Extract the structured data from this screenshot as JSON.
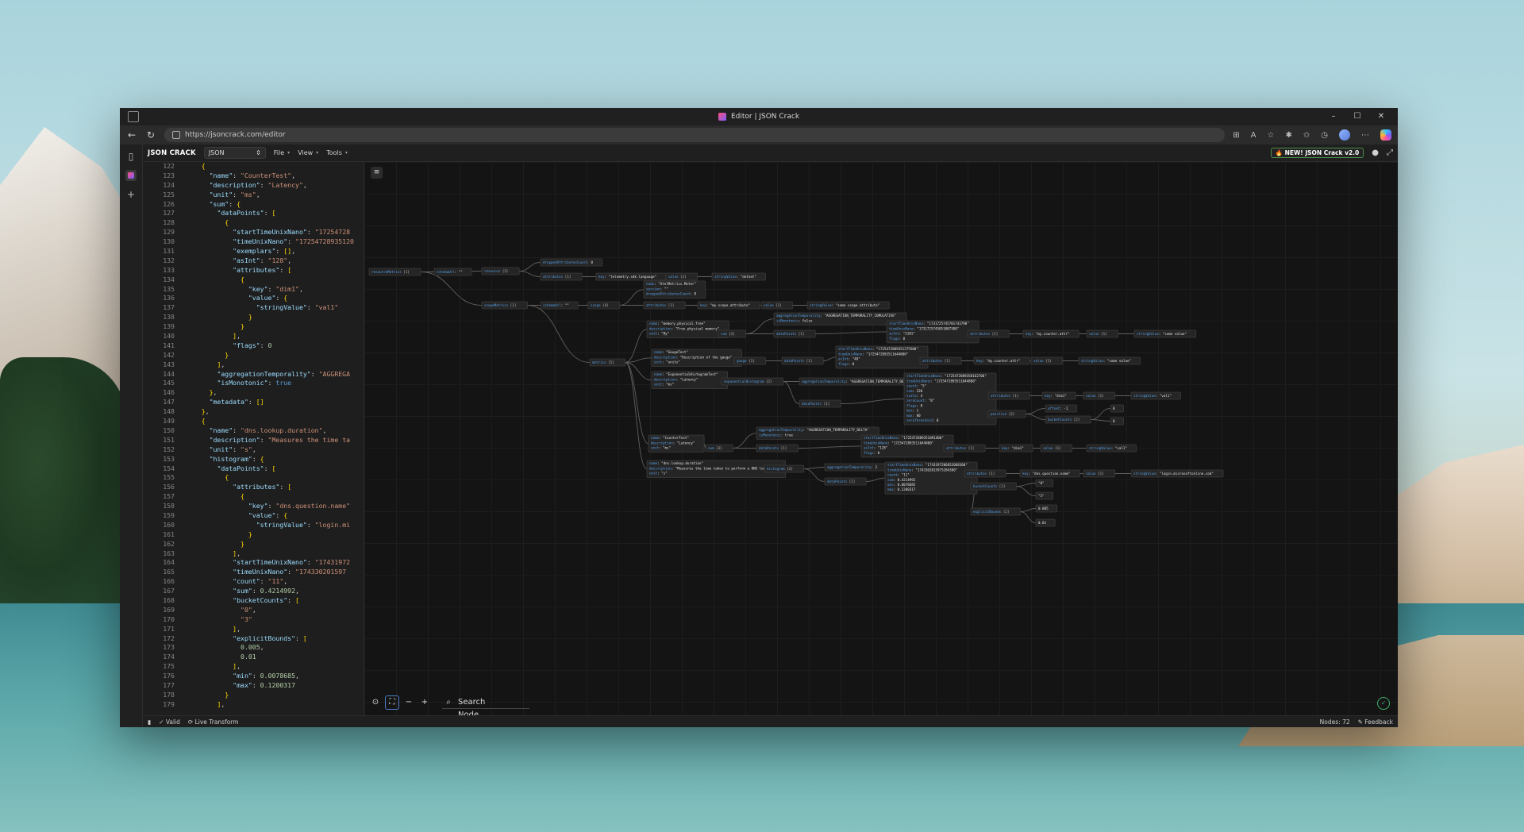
{
  "browser": {
    "tab_title": "Editor | JSON Crack",
    "url": "https://jsoncrack.com/editor"
  },
  "app": {
    "brand": "JSON CRACK",
    "format": "JSON",
    "menus": [
      "File",
      "View",
      "Tools"
    ],
    "new_button": "NEW! JSON Crack v2.0"
  },
  "editor": {
    "lines": [
      {
        "n": "122",
        "t": "    {"
      },
      {
        "n": "123",
        "t": "      \"name\": \"CounterTest\","
      },
      {
        "n": "124",
        "t": "      \"description\": \"Latency\","
      },
      {
        "n": "125",
        "t": "      \"unit\": \"ms\","
      },
      {
        "n": "126",
        "t": "      \"sum\": {"
      },
      {
        "n": "127",
        "t": "        \"dataPoints\": ["
      },
      {
        "n": "128",
        "t": "          {"
      },
      {
        "n": "129",
        "t": "            \"startTimeUnixNano\": \"17254728"
      },
      {
        "n": "130",
        "t": "            \"timeUnixNano\": \"17254728935120"
      },
      {
        "n": "131",
        "t": "            \"exemplars\": [],"
      },
      {
        "n": "132",
        "t": "            \"asInt\": \"128\","
      },
      {
        "n": "133",
        "t": "            \"attributes\": ["
      },
      {
        "n": "134",
        "t": "              {"
      },
      {
        "n": "135",
        "t": "                \"key\": \"dim1\","
      },
      {
        "n": "136",
        "t": "                \"value\": {"
      },
      {
        "n": "137",
        "t": "                  \"stringValue\": \"val1\""
      },
      {
        "n": "138",
        "t": "                }"
      },
      {
        "n": "139",
        "t": "              }"
      },
      {
        "n": "140",
        "t": "            ],"
      },
      {
        "n": "141",
        "t": "            \"flags\": 0"
      },
      {
        "n": "142",
        "t": "          }"
      },
      {
        "n": "143",
        "t": "        ],"
      },
      {
        "n": "144",
        "t": "        \"aggregationTemporality\": \"AGGREGA"
      },
      {
        "n": "145",
        "t": "        \"isMonotonic\": true"
      },
      {
        "n": "146",
        "t": "      },"
      },
      {
        "n": "147",
        "t": "      \"metadata\": []"
      },
      {
        "n": "148",
        "t": "    },"
      },
      {
        "n": "149",
        "t": "    {"
      },
      {
        "n": "150",
        "t": "      \"name\": \"dns.lookup.duration\","
      },
      {
        "n": "151",
        "t": "      \"description\": \"Measures the time ta"
      },
      {
        "n": "152",
        "t": "      \"unit\": \"s\","
      },
      {
        "n": "153",
        "t": "      \"histogram\": {"
      },
      {
        "n": "154",
        "t": "        \"dataPoints\": ["
      },
      {
        "n": "155",
        "t": "          {"
      },
      {
        "n": "156",
        "t": "            \"attributes\": ["
      },
      {
        "n": "157",
        "t": "              {"
      },
      {
        "n": "158",
        "t": "                \"key\": \"dns.question.name\""
      },
      {
        "n": "159",
        "t": "                \"value\": {"
      },
      {
        "n": "160",
        "t": "                  \"stringValue\": \"login.mi"
      },
      {
        "n": "161",
        "t": "                }"
      },
      {
        "n": "162",
        "t": "              }"
      },
      {
        "n": "163",
        "t": "            ],"
      },
      {
        "n": "164",
        "t": "            \"startTimeUnixNano\": \"17431972"
      },
      {
        "n": "165",
        "t": "            \"timeUnixNano\": \"174330201597"
      },
      {
        "n": "166",
        "t": "            \"count\": \"11\","
      },
      {
        "n": "167",
        "t": "            \"sum\": 0.4214992,"
      },
      {
        "n": "168",
        "t": "            \"bucketCounts\": ["
      },
      {
        "n": "169",
        "t": "              \"0\","
      },
      {
        "n": "170",
        "t": "              \"3\""
      },
      {
        "n": "171",
        "t": "            ],"
      },
      {
        "n": "172",
        "t": "            \"explicitBounds\": ["
      },
      {
        "n": "173",
        "t": "              0.005,"
      },
      {
        "n": "174",
        "t": "              0.01"
      },
      {
        "n": "175",
        "t": "            ],"
      },
      {
        "n": "176",
        "t": "            \"min\": 0.0078685,"
      },
      {
        "n": "177",
        "t": "            \"max\": 0.1200317"
      },
      {
        "n": "178",
        "t": "          }"
      },
      {
        "n": "179",
        "t": "        ],"
      }
    ]
  },
  "graph": {
    "nodes": [
      {
        "id": "rm",
        "lines": [
          {
            "k": "resourceMetrics",
            "v": "[1]"
          }
        ]
      },
      {
        "id": "sm0",
        "lines": [
          {
            "k": "schemaUrl",
            "v": "\"\""
          }
        ]
      },
      {
        "id": "res",
        "lines": [
          {
            "k": "resource",
            "v": "{2}"
          }
        ]
      },
      {
        "id": "drop1",
        "lines": [
          {
            "k": "droppedAttributesCount",
            "v": "0"
          }
        ]
      },
      {
        "id": "attr1",
        "lines": [
          {
            "k": "attributes",
            "v": "[1]"
          }
        ]
      },
      {
        "id": "key1",
        "lines": [
          {
            "k": "key",
            "v": "\"telemetry.sdk.language\""
          }
        ]
      },
      {
        "id": "val1",
        "lines": [
          {
            "k": "value",
            "v": "{1}"
          }
        ]
      },
      {
        "id": "sv1",
        "lines": [
          {
            "k": "stringValue",
            "v": "\"dotnet\""
          }
        ]
      },
      {
        "id": "scm",
        "lines": [
          {
            "k": "scopeMetrics",
            "v": "[1]"
          }
        ]
      },
      {
        "id": "sm1",
        "lines": [
          {
            "k": "schemaUrl",
            "v": "\"\""
          }
        ]
      },
      {
        "id": "scope",
        "lines": [
          {
            "k": "scope",
            "v": "{4}"
          }
        ]
      },
      {
        "id": "scopeinfo",
        "lines": [
          {
            "k": "name",
            "v": "\"OtelMetrics.Meter\""
          },
          {
            "k": "version",
            "v": "\"\""
          },
          {
            "k": "droppedAttributesCount",
            "v": "0"
          }
        ]
      },
      {
        "id": "attr2",
        "lines": [
          {
            "k": "attributes",
            "v": "[1]"
          }
        ]
      },
      {
        "id": "key2",
        "lines": [
          {
            "k": "key",
            "v": "\"my.scope.attribute\""
          }
        ]
      },
      {
        "id": "val2",
        "lines": [
          {
            "k": "value",
            "v": "{1}"
          }
        ]
      },
      {
        "id": "sv2",
        "lines": [
          {
            "k": "stringValue",
            "v": "\"some scope attribute\""
          }
        ]
      },
      {
        "id": "metrics",
        "lines": [
          {
            "k": "metrics",
            "v": "[5]"
          }
        ]
      },
      {
        "id": "m1",
        "lines": [
          {
            "k": "name",
            "v": "\"memory.physical.free\""
          },
          {
            "k": "description",
            "v": "\"Free physical memory\""
          },
          {
            "k": "unit",
            "v": "\"By\""
          }
        ]
      },
      {
        "id": "sum1",
        "lines": [
          {
            "k": "sum",
            "v": "{3}"
          }
        ]
      },
      {
        "id": "agg1",
        "lines": [
          {
            "k": "aggregationTemporality",
            "v": "\"AGGREGATION_TEMPORALITY_CUMULATIVE\""
          },
          {
            "k": "isMonotonic",
            "v": "false"
          }
        ]
      },
      {
        "id": "dp1",
        "lines": [
          {
            "k": "dataPoints",
            "v": "[1]"
          }
        ]
      },
      {
        "id": "dp1v",
        "lines": [
          {
            "k": "startTimeUnixNano",
            "v": "\"1731725745701743790\""
          },
          {
            "k": "timeUnixNano",
            "v": "\"1731725745851007300\""
          },
          {
            "k": "asInt",
            "v": "\"2101\""
          },
          {
            "k": "flags",
            "v": "0"
          }
        ]
      },
      {
        "id": "attr3",
        "lines": [
          {
            "k": "attributes",
            "v": "[1]"
          }
        ]
      },
      {
        "id": "key3",
        "lines": [
          {
            "k": "key",
            "v": "\"my.counter.attr\""
          }
        ]
      },
      {
        "id": "val3",
        "lines": [
          {
            "k": "value",
            "v": "{1}"
          }
        ]
      },
      {
        "id": "sv3",
        "lines": [
          {
            "k": "stringValue",
            "v": "\"some value\""
          }
        ]
      },
      {
        "id": "m2",
        "lines": [
          {
            "k": "name",
            "v": "\"GaugeTest\""
          },
          {
            "k": "description",
            "v": "\"Description of the gauge\""
          },
          {
            "k": "unit",
            "v": "\"units\""
          }
        ]
      },
      {
        "id": "gauge",
        "lines": [
          {
            "k": "gauge",
            "v": "{1}"
          }
        ]
      },
      {
        "id": "dp2",
        "lines": [
          {
            "k": "dataPoints",
            "v": "[1]"
          }
        ]
      },
      {
        "id": "dp2v",
        "lines": [
          {
            "k": "startTimeUnixNano",
            "v": "\"1725472889351275500\""
          },
          {
            "k": "timeUnixNano",
            "v": "\"1725472893511644800\""
          },
          {
            "k": "asInt",
            "v": "\"40\""
          },
          {
            "k": "flags",
            "v": "0"
          }
        ]
      },
      {
        "id": "attr4",
        "lines": [
          {
            "k": "attributes",
            "v": "[1]"
          }
        ]
      },
      {
        "id": "key4",
        "lines": [
          {
            "k": "key",
            "v": "\"my.counter.attr\""
          }
        ]
      },
      {
        "id": "val4",
        "lines": [
          {
            "k": "value",
            "v": "{1}"
          }
        ]
      },
      {
        "id": "sv4",
        "lines": [
          {
            "k": "stringValue",
            "v": "\"some value\""
          }
        ]
      },
      {
        "id": "m3",
        "lines": [
          {
            "k": "name",
            "v": "\"ExponentialHistogramTest\""
          },
          {
            "k": "description",
            "v": "\"Latency\""
          },
          {
            "k": "unit",
            "v": "\"ms\""
          }
        ]
      },
      {
        "id": "eh",
        "lines": [
          {
            "k": "exponentialHistogram",
            "v": "{2}"
          }
        ]
      },
      {
        "id": "agg3",
        "lines": [
          {
            "k": "aggregationTemporality",
            "v": "\"AGGREGATION_TEMPORALITY_DELTA\""
          }
        ]
      },
      {
        "id": "dp3",
        "lines": [
          {
            "k": "dataPoints",
            "v": "[1]"
          }
        ]
      },
      {
        "id": "dp3v",
        "lines": [
          {
            "k": "startTimeUnixNano",
            "v": "\"1725472889350162700\""
          },
          {
            "k": "timeUnixNano",
            "v": "\"1725472893511644800\""
          },
          {
            "k": "count",
            "v": "\"5\""
          },
          {
            "k": "sum",
            "v": "220"
          },
          {
            "k": "scale",
            "v": "4"
          },
          {
            "k": "zeroCount",
            "v": "\"0\""
          },
          {
            "k": "flags",
            "v": "0"
          },
          {
            "k": "min",
            "v": "1"
          },
          {
            "k": "max",
            "v": "80"
          },
          {
            "k": "zeroThreshold",
            "v": "0"
          }
        ]
      },
      {
        "id": "attr5",
        "lines": [
          {
            "k": "attributes",
            "v": "[1]"
          }
        ]
      },
      {
        "id": "key5",
        "lines": [
          {
            "k": "key",
            "v": "\"dim1\""
          }
        ]
      },
      {
        "id": "val5",
        "lines": [
          {
            "k": "value",
            "v": "{1}"
          }
        ]
      },
      {
        "id": "sv5",
        "lines": [
          {
            "k": "stringValue",
            "v": "\"val1\""
          }
        ]
      },
      {
        "id": "pos",
        "lines": [
          {
            "k": "positive",
            "v": "{2}"
          }
        ]
      },
      {
        "id": "offset",
        "lines": [
          {
            "k": "offset",
            "v": "-1"
          }
        ]
      },
      {
        "id": "bc1",
        "lines": [
          {
            "k": "bucketCounts",
            "v": "[2]"
          }
        ]
      },
      {
        "id": "b1a",
        "lines": [
          {
            "k": "",
            "v": "0"
          }
        ]
      },
      {
        "id": "b1b",
        "lines": [
          {
            "k": "",
            "v": "0"
          }
        ]
      },
      {
        "id": "m4",
        "lines": [
          {
            "k": "name",
            "v": "\"CounterTest\""
          },
          {
            "k": "description",
            "v": "\"Latency\""
          },
          {
            "k": "unit",
            "v": "\"ms\""
          }
        ]
      },
      {
        "id": "sum4",
        "lines": [
          {
            "k": "sum",
            "v": "{3}"
          }
        ]
      },
      {
        "id": "agg4",
        "lines": [
          {
            "k": "aggregationTemporality",
            "v": "\"AGGREGATION_TEMPORALITY_DELTA\""
          },
          {
            "k": "isMonotonic",
            "v": "true"
          }
        ]
      },
      {
        "id": "dp4",
        "lines": [
          {
            "k": "dataPoints",
            "v": "[1]"
          }
        ]
      },
      {
        "id": "dp4v",
        "lines": [
          {
            "k": "startTimeUnixNano",
            "v": "\"1725472889351091400\""
          },
          {
            "k": "timeUnixNano",
            "v": "\"1725472893511644800\""
          },
          {
            "k": "asInt",
            "v": "\"128\""
          },
          {
            "k": "flags",
            "v": "0"
          }
        ]
      },
      {
        "id": "attr6",
        "lines": [
          {
            "k": "attributes",
            "v": "[1]"
          }
        ]
      },
      {
        "id": "key6",
        "lines": [
          {
            "k": "key",
            "v": "\"dim1\""
          }
        ]
      },
      {
        "id": "val6",
        "lines": [
          {
            "k": "value",
            "v": "{1}"
          }
        ]
      },
      {
        "id": "sv6",
        "lines": [
          {
            "k": "stringValue",
            "v": "\"val1\""
          }
        ]
      },
      {
        "id": "m5",
        "lines": [
          {
            "k": "name",
            "v": "\"dns.lookup.duration\""
          },
          {
            "k": "description",
            "v": "\"Measures the time taken to perform a DNS lookup.\""
          },
          {
            "k": "unit",
            "v": "\"s\""
          }
        ]
      },
      {
        "id": "hist",
        "lines": [
          {
            "k": "histogram",
            "v": "{2}"
          }
        ]
      },
      {
        "id": "agg5",
        "lines": [
          {
            "k": "aggregationTemporality",
            "v": "2"
          }
        ]
      },
      {
        "id": "dp5",
        "lines": [
          {
            "k": "dataPoints",
            "v": "[1]"
          }
        ]
      },
      {
        "id": "dp5v",
        "lines": [
          {
            "k": "startTimeUnixNano",
            "v": "\"1743197206852068300\""
          },
          {
            "k": "timeUnixNano",
            "v": "\"1743302015975284300\""
          },
          {
            "k": "count",
            "v": "\"11\""
          },
          {
            "k": "sum",
            "v": "0.4214992"
          },
          {
            "k": "min",
            "v": "0.0078685"
          },
          {
            "k": "max",
            "v": "0.1200317"
          }
        ]
      },
      {
        "id": "attr7",
        "lines": [
          {
            "k": "attributes",
            "v": "[1]"
          }
        ]
      },
      {
        "id": "key7",
        "lines": [
          {
            "k": "key",
            "v": "\"dns.question.name\""
          }
        ]
      },
      {
        "id": "val7",
        "lines": [
          {
            "k": "value",
            "v": "{1}"
          }
        ]
      },
      {
        "id": "sv7",
        "lines": [
          {
            "k": "stringValue",
            "v": "\"login.microsoftonline.com\""
          }
        ]
      },
      {
        "id": "bc5",
        "lines": [
          {
            "k": "bucketCounts",
            "v": "[2]"
          }
        ]
      },
      {
        "id": "b5a",
        "lines": [
          {
            "k": "",
            "v": "\"0\""
          }
        ]
      },
      {
        "id": "b5b",
        "lines": [
          {
            "k": "",
            "v": "\"3\""
          }
        ]
      },
      {
        "id": "eb5",
        "lines": [
          {
            "k": "explicitBounds",
            "v": "[2]"
          }
        ]
      },
      {
        "id": "e5a",
        "lines": [
          {
            "k": "",
            "v": "0.005"
          }
        ]
      },
      {
        "id": "e5b",
        "lines": [
          {
            "k": "",
            "v": "0.01"
          }
        ]
      }
    ]
  },
  "canvas": {
    "search_placeholder": "Search Node"
  },
  "status": {
    "valid": "Valid",
    "live": "Live Transform",
    "nodes": "Nodes: 72",
    "feedback": "Feedback"
  }
}
